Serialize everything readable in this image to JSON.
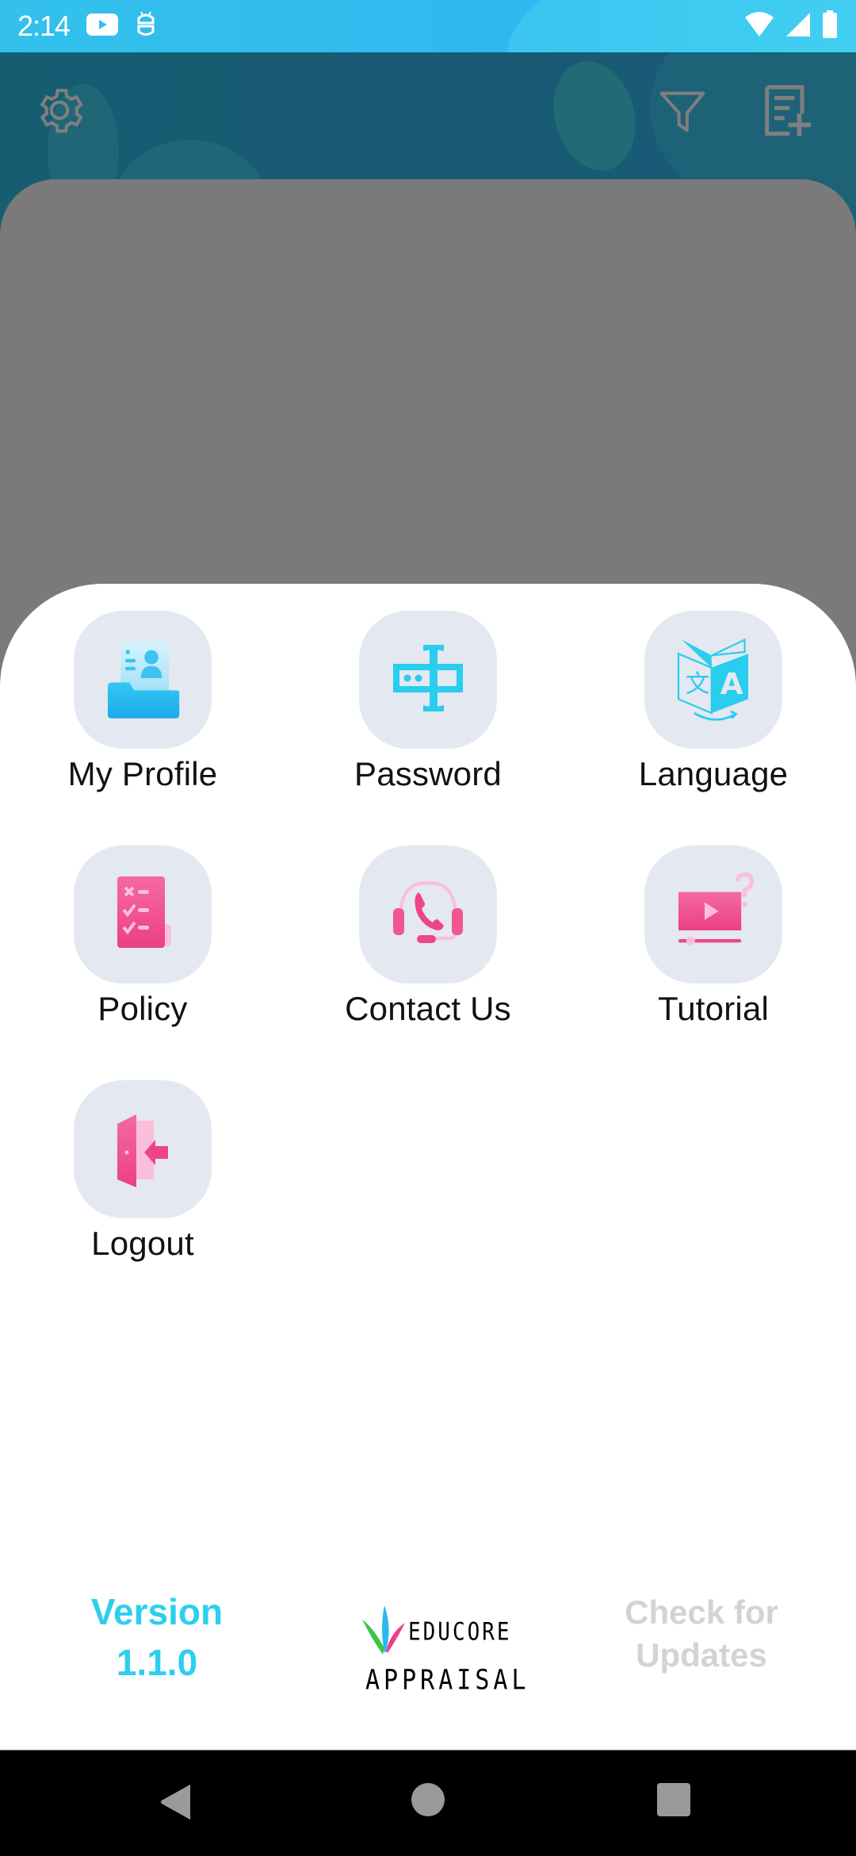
{
  "status_bar": {
    "time": "2:14",
    "notification_icons": [
      "youtube-icon",
      "android-debug-icon"
    ],
    "system_icons": [
      "wifi-icon",
      "cellular-signal-icon",
      "battery-icon"
    ]
  },
  "header": {
    "left_icon": "gear-icon",
    "right_icons": [
      "filter-icon",
      "add-note-icon"
    ]
  },
  "menu": {
    "items": [
      {
        "label": "My Profile",
        "icon": "profile-folder-icon"
      },
      {
        "label": "Password",
        "icon": "password-field-icon"
      },
      {
        "label": "Language",
        "icon": "translate-icon"
      },
      {
        "label": "Policy",
        "icon": "checklist-policy-icon"
      },
      {
        "label": "Contact Us",
        "icon": "headset-phone-icon"
      },
      {
        "label": "Tutorial",
        "icon": "video-tutorial-icon"
      },
      {
        "label": "Logout",
        "icon": "logout-door-icon"
      }
    ]
  },
  "footer": {
    "version_label": "Version",
    "version_number": "1.1.0",
    "logo_brand": "EDUCORE",
    "logo_product": "APPRAISAL",
    "check_updates_line1": "Check for",
    "check_updates_line2": "Updates"
  },
  "colors": {
    "accent_cyan": "#2ccfee",
    "accent_pink": "#ef4b8c",
    "tile_background": "#e3e8f1",
    "disabled_text": "#d3d3d3"
  },
  "nav_bar": {
    "buttons": [
      "back",
      "home",
      "recents"
    ]
  }
}
